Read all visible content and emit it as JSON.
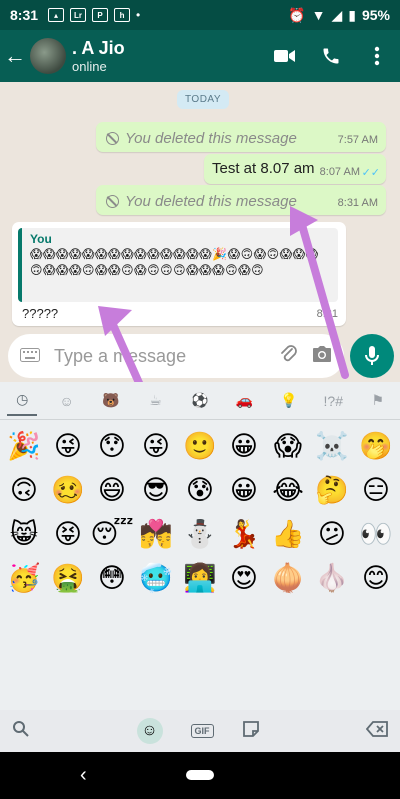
{
  "status": {
    "time": "8:31",
    "battery": "95%",
    "icons": [
      "gallery-icon",
      "lr-icon",
      "p-icon",
      "h-icon"
    ]
  },
  "header": {
    "contact_name": ". A Jio",
    "contact_status": "online"
  },
  "chat": {
    "date": "TODAY",
    "messages": [
      {
        "text": "You deleted this message",
        "time": "7:57 AM"
      },
      {
        "text": "Test at 8.07 am",
        "time": "8:07 AM"
      },
      {
        "text": "You deleted this message",
        "time": "8:31 AM"
      },
      {
        "quote_author": "You",
        "quote_emojis": "😱😱😱😱😱😱😱😱😱😱😱😱😱😱🎉😱🙃😱🙃😱😱😱🙃😱😱😱🙃😱😱🙃😱🙃🙃🙃😱😱😱🙃😱🙃",
        "text": "?????",
        "time": "8:31"
      }
    ]
  },
  "input": {
    "placeholder": "Type a message"
  },
  "emoji_tabs": [
    "recent-icon",
    "smiley-icon",
    "animal-icon",
    "food-icon",
    "sport-icon",
    "car-icon",
    "bulb-icon",
    "symbols-icon",
    "flag-icon"
  ],
  "emoji_rows": [
    [
      "🎉",
      "😜",
      "😯",
      "😜",
      "🙂",
      "😀",
      "😱",
      "☠️",
      "🤭"
    ],
    [
      "🙃",
      "🥴",
      "😄",
      "😎",
      "😰",
      "😀",
      "😂",
      "🤔",
      "😑"
    ],
    [
      "😸",
      "😝",
      "😴",
      "💏",
      "⛄",
      "💃",
      "👍",
      "😕",
      "👀"
    ],
    [
      "🥳",
      "🤮",
      "😳",
      "🥶",
      "👩‍💻",
      "😍",
      "🧅",
      "🧄",
      "😊"
    ]
  ],
  "colors": {
    "header": "#075e54",
    "status": "#054d44",
    "outgoing": "#dcf8c6",
    "accent": "#00897b",
    "arrow": "#c77ddb"
  }
}
